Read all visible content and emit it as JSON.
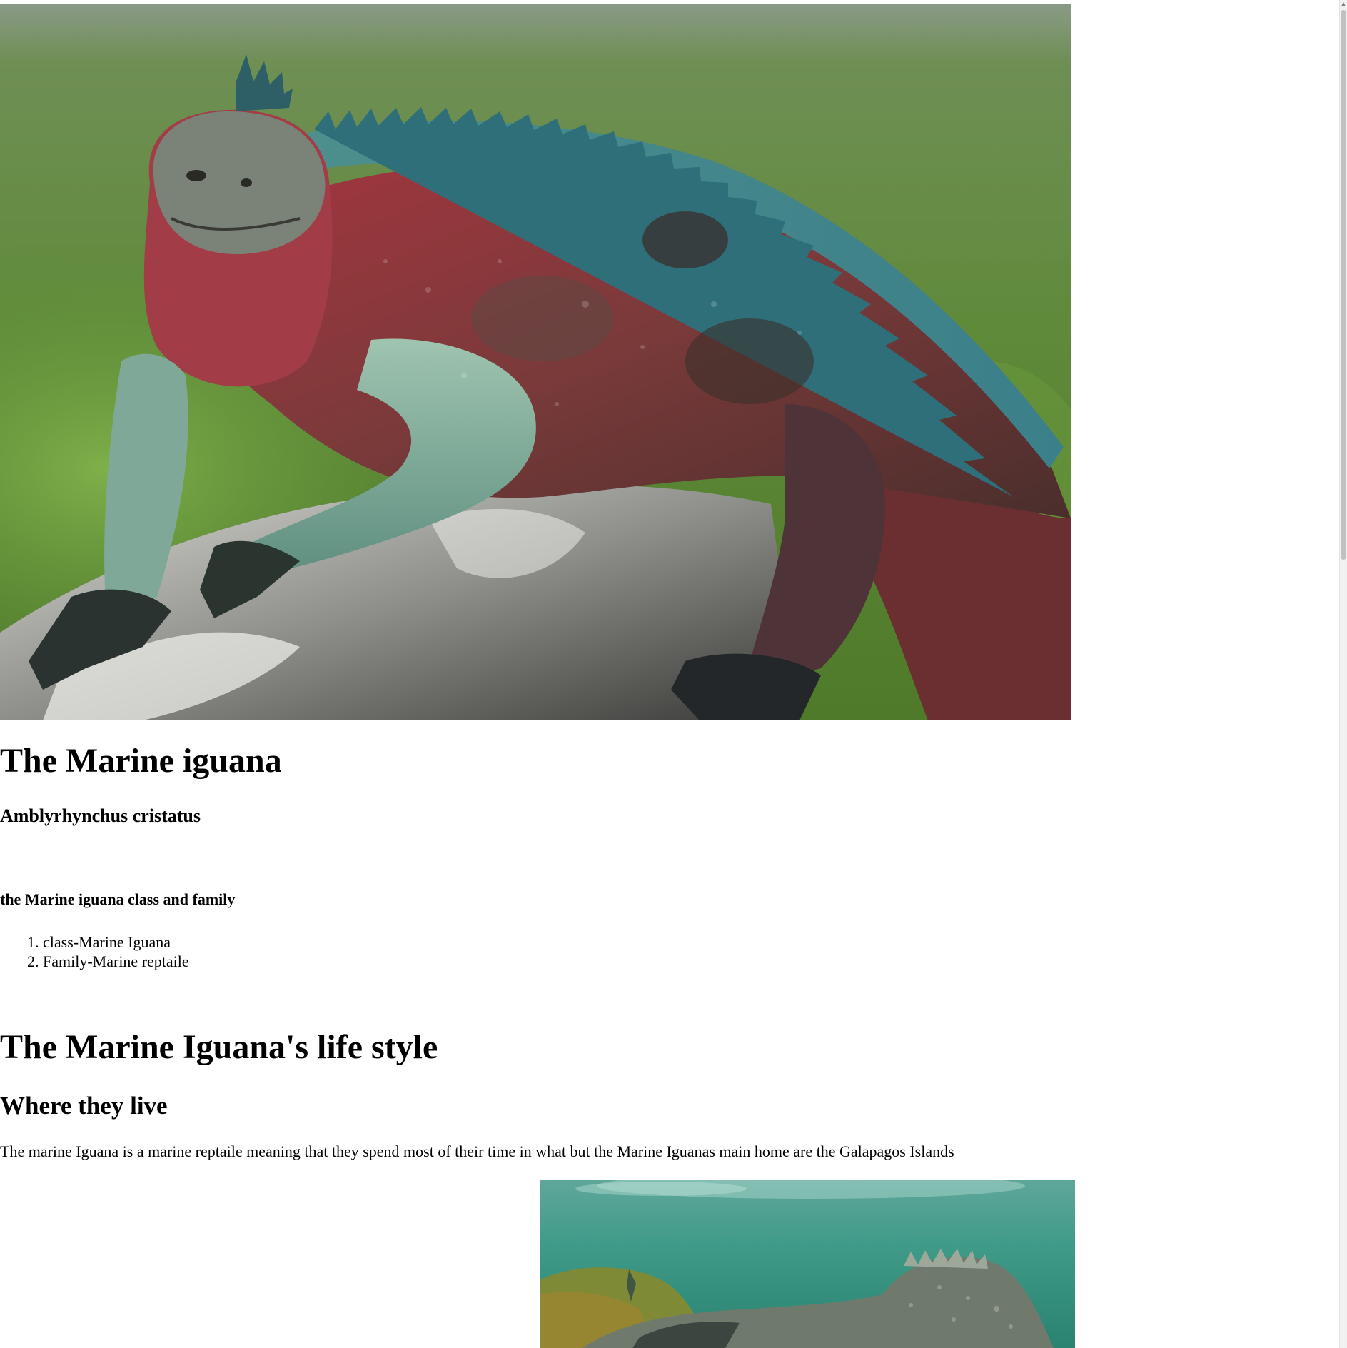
{
  "hero_image": {
    "alt": "marine-iguana-photo"
  },
  "title": "The Marine iguana",
  "scientific_name": "Amblyrhynchus cristatus",
  "classification": {
    "heading": "the Marine iguana class and family",
    "items": [
      "class-Marine Iguana",
      "Family-Marine reptaile"
    ]
  },
  "life_style": {
    "heading": "The Marine Iguana's life style",
    "where_heading": "Where they live",
    "where_text": "The marine Iguana is a marine reptaile meaning that they spend most of their time in what but the Marine Iguanas main home are the Galapagos Islands"
  },
  "second_image": {
    "alt": "marine-iguana-underwater-photo"
  },
  "colors": {
    "background": "#ffffff",
    "text": "#000000",
    "scrollbar_thumb": "#c1c1c1"
  }
}
